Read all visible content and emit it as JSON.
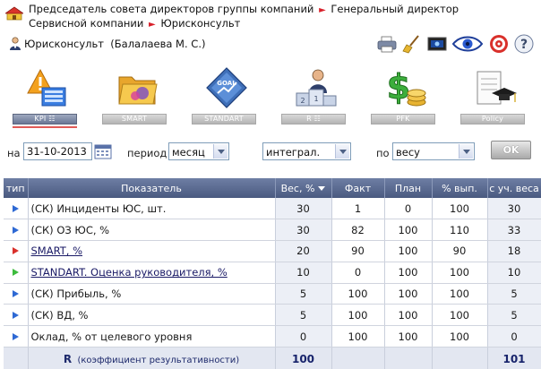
{
  "breadcrumb": {
    "part1": "Председатель совета директоров группы компаний",
    "part2": "Генеральный директор Сервисной компании",
    "part3": "Юрисконсульт"
  },
  "user": {
    "role": "Юрисконсульт",
    "name": "(Балалаева М. С.)"
  },
  "toolbar_icons": [
    "printer-icon",
    "broom-icon",
    "monitor-icon",
    "eye-icon",
    "target-icon",
    "help-icon"
  ],
  "modules": [
    {
      "label": "KPI ☷",
      "icon": "warning-chart-icon",
      "active": true
    },
    {
      "label": "SMART",
      "icon": "folders-icon",
      "active": false
    },
    {
      "label": "STANDART",
      "icon": "goal-icon",
      "active": false
    },
    {
      "label": "R ☷",
      "icon": "podium-icon",
      "active": false
    },
    {
      "label": "PFK",
      "icon": "money-icon",
      "active": false
    },
    {
      "label": "Policy",
      "icon": "graduation-icon",
      "active": false
    }
  ],
  "filters": {
    "date_label": "на",
    "date_value": "31-10-2013",
    "period_label": "период",
    "period_value": "месяц",
    "mode_value": "интеграл.",
    "by_label": "по",
    "by_value": "весу",
    "ok_label": "OK"
  },
  "table": {
    "headers": [
      "тип",
      "Показатель",
      "Вес, %",
      "Факт",
      "План",
      "% вып.",
      "с уч. веса"
    ],
    "rows": [
      {
        "type_color": "#2e69d4",
        "name": "(СК) Инциденты ЮС, шт.",
        "link": false,
        "weight": "30",
        "fact": "1",
        "plan": "0",
        "pct": "100",
        "weighted": "30"
      },
      {
        "type_color": "#2e69d4",
        "name": "(СК) ОЗ ЮС, %",
        "link": false,
        "weight": "30",
        "fact": "82",
        "plan": "100",
        "pct": "110",
        "weighted": "33"
      },
      {
        "type_color": "#d9302b",
        "name": "SMART, %",
        "link": true,
        "weight": "20",
        "fact": "90",
        "plan": "100",
        "pct": "90",
        "weighted": "18"
      },
      {
        "type_color": "#3dbb3d",
        "name": "STANDART. Оценка руководителя, %",
        "link": true,
        "weight": "10",
        "fact": "0",
        "plan": "100",
        "pct": "100",
        "weighted": "10"
      },
      {
        "type_color": "#2e69d4",
        "name": "(СК) Прибыль, %",
        "link": false,
        "weight": "5",
        "fact": "100",
        "plan": "100",
        "pct": "100",
        "weighted": "5"
      },
      {
        "type_color": "#2e69d4",
        "name": "(СК) ВД, %",
        "link": false,
        "weight": "5",
        "fact": "100",
        "plan": "100",
        "pct": "100",
        "weighted": "5"
      },
      {
        "type_color": "#2e69d4",
        "name": "Оклад, % от целевого уровня",
        "link": false,
        "weight": "0",
        "fact": "100",
        "plan": "100",
        "pct": "100",
        "weighted": "0"
      }
    ],
    "total": {
      "label_r": "R",
      "label_text": "(коэффициент результативности)",
      "weight": "100",
      "weighted": "101"
    }
  },
  "colors": {
    "accent_red": "#d8202a",
    "header_blue": "#5a6a90",
    "active_tab": "#7481a0"
  }
}
